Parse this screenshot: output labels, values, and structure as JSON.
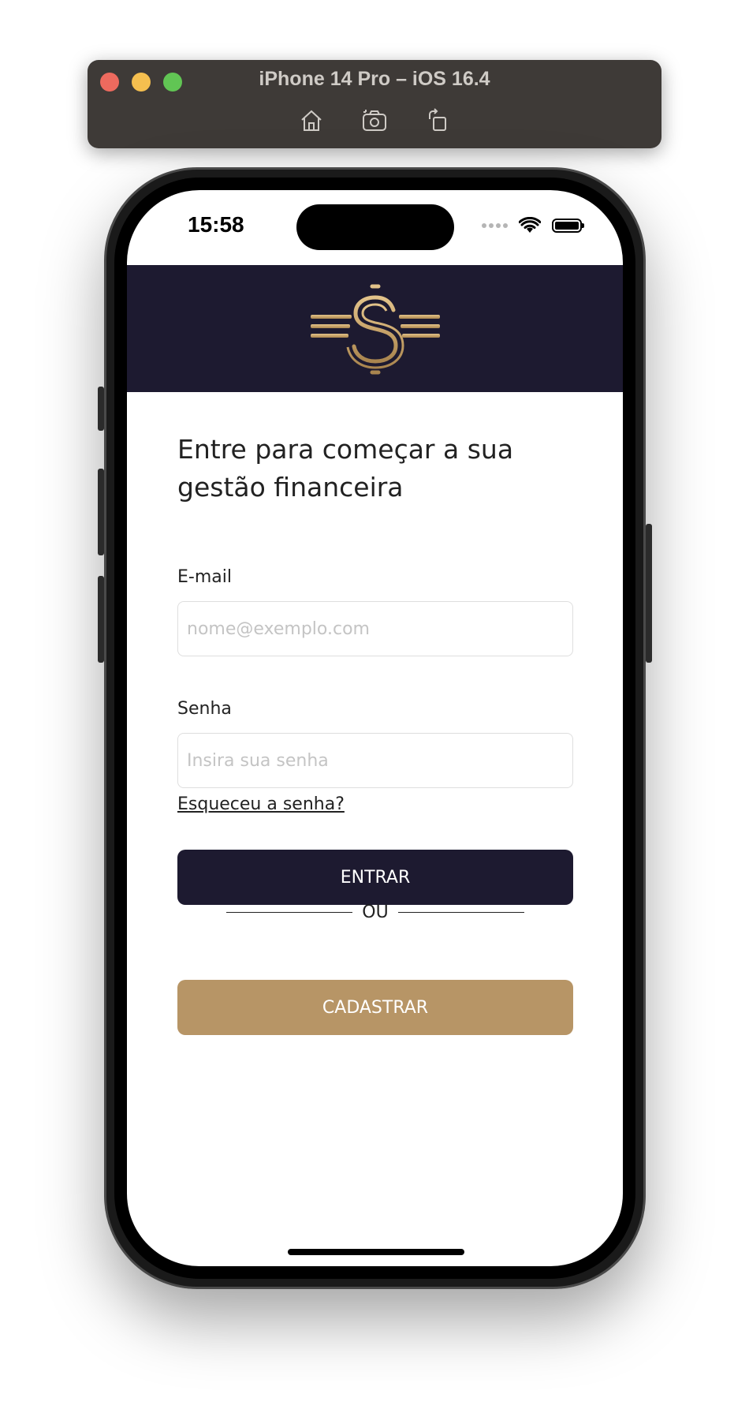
{
  "simulator": {
    "title": "iPhone 14 Pro – iOS 16.4",
    "tools": [
      "home-icon",
      "screenshot-icon",
      "rotate-icon"
    ]
  },
  "status_bar": {
    "time": "15:58"
  },
  "header": {
    "logo": "dollar-sign-logo",
    "background": "#1d1a30",
    "accent": "#c9a56b"
  },
  "login": {
    "heading": "Entre para começar a sua gestão financeira",
    "email_label": "E-mail",
    "email_placeholder": "nome@exemplo.com",
    "email_value": "",
    "password_label": "Senha",
    "password_placeholder": "Insira sua senha",
    "password_value": "",
    "forgot_link": "Esqueceu a senha?",
    "login_button": "ENTRAR",
    "divider_text": "OU",
    "register_button": "CADASTRAR"
  },
  "colors": {
    "primary": "#1d1a30",
    "secondary": "#b79566"
  }
}
